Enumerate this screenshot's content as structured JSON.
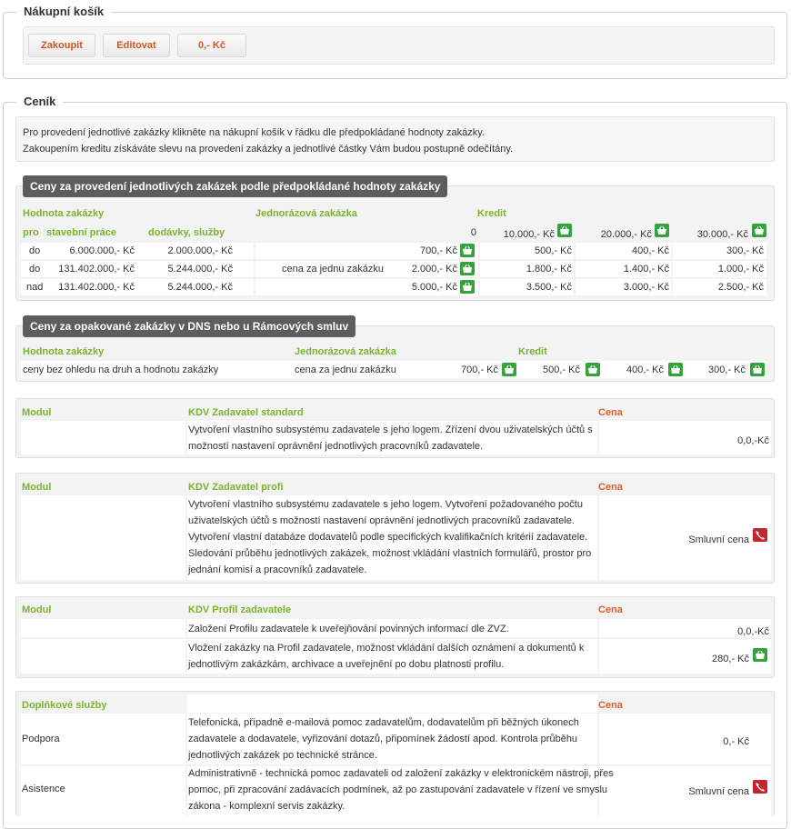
{
  "cart": {
    "title": "Nákupní košík",
    "buttons": {
      "buy": "Zakoupit",
      "edit": "Editovat",
      "total": "0,- Kč"
    }
  },
  "price": {
    "title": "Ceník",
    "info1": "Pro provedení jednotlivé zakázky klikněte na nákupní košík v řádku dle předpokládané hodnoty zakázky.",
    "info2": "Zakoupením kreditu získáváte slevu na provedení zakázky a jednotlivé částky Vám budou postupně odečítány."
  },
  "t1": {
    "title": "Ceny za provedení jednotlivých zakázek podle předpokládané hodnoty zakázky",
    "h_value": "Hodnota zakázky",
    "h_single": "Jednorázová zakázka",
    "h_credit": "Kredit",
    "h_pro": "pro",
    "h_construction": "stavební práce",
    "h_supplies": "dodávky, služby",
    "credit_zero": "0",
    "credits": [
      "10.000,- Kč",
      "20.000,- Kč",
      "30.000,- Kč"
    ],
    "single_note": "cena za jednu zakázku",
    "rows": [
      {
        "pro": "do",
        "construction": "6.000.000,- Kč",
        "supplies": "2.000.000,- Kč",
        "single": "700,- Kč",
        "c1": "500,- Kč",
        "c2": "400,- Kč",
        "c3": "300,- Kč"
      },
      {
        "pro": "do",
        "construction": "131.402.000,- Kč",
        "supplies": "5.244.000,- Kč",
        "single": "2.000,- Kč",
        "c1": "1.800,- Kč",
        "c2": "1.400,- Kč",
        "c3": "1.000,- Kč"
      },
      {
        "pro": "nad",
        "construction": "131.402.000,- Kč",
        "supplies": "5.244.000,- Kč",
        "single": "5.000,- Kč",
        "c1": "3.500,- Kč",
        "c2": "3.000,- Kč",
        "c3": "2.500,- Kč"
      }
    ]
  },
  "t2": {
    "title": "Ceny za opakované zakázky v DNS nebo u Rámcových smluv",
    "h_value": "Hodnota zakázky",
    "h_single": "Jednorázová zakázka",
    "h_credit": "Kredit",
    "row_label": "ceny bez ohledu na druh a hodnotu zakázky",
    "single_note": "cena za jednu zakázku",
    "single": "700,- Kč",
    "c1": "500,- Kč",
    "c2": "400,- Kč",
    "c3": "300,- Kč"
  },
  "m1": {
    "h_module": "Modul",
    "name": "KDV Zadavatel standard",
    "h_price": "Cena",
    "desc1": "Vytvoření vlastního subsystému zadavatele s jeho logem. Zřízení dvou uživatelských účtů s",
    "desc2": "možností nastavení oprávnění jednotlivých pracovníků zadavatele.",
    "price": "0,0,-Kč"
  },
  "m2": {
    "h_module": "Modul",
    "name": "KDV Zadavatel profi",
    "h_price": "Cena",
    "desc": [
      "Vytvoření vlastního subsystému zadavatele s jeho logem. Vytvoření požadovaného počtu",
      "uživatelských účtů s možností nastavení oprávnění jednotlivých pracovníků zadavatele.",
      "Vytvoření vlastní databáze dodavatelů podle specifických kvalifikačních kritérií zadavatele.",
      "Sledování průběhu jednotlivých zakázek, možnost vkládání vlastních formulářů, prostor pro",
      "jednání komisí a pracovníků zadavatele."
    ],
    "price": "Smluvní cena"
  },
  "m3": {
    "h_module": "Modul",
    "name": "KDV Profil zadavatele",
    "h_price": "Cena",
    "r1_desc": "Založení Profilu zadavatele k uveřejňování povinných informací dle ZVZ.",
    "r1_price": "0,0,-Kč",
    "r2_desc1": "Vložení zakázky na Profil zadavatele, možnost vkládání dalších oznámení a dokumentů k",
    "r2_desc2": "jednotlivým zakázkám, archivace a uveřejnění po dobu platnosti profilu.",
    "r2_price": "280,- Kč"
  },
  "m4": {
    "h_title": "Doplňkové služby",
    "h_price": "Cena",
    "r1_label": "Podpora",
    "r1_desc": [
      "Telefonická, případně e-mailová pomoc zadavatelům, dodavatelům při běžných úkonech",
      "zadavatele a dodavatele, vyřizování dotazů, připomínek žádostí apod. Kontrola průběhu",
      "jednotlivých zakázek po technické stránce."
    ],
    "r1_price": "0,- Kč",
    "r2_label": "Asistence",
    "r2_desc": [
      "Administrativně - technická pomoc zadavateli od založení zakázky v elektronickém nástroji, přes",
      "pomoc, při zpracování zadávacích podmínek, až po zastupování zadavatele v řízení ve smyslu",
      "zákona - komplexní servis zakázky."
    ],
    "r2_price": "Smluvní cena"
  },
  "icons": {
    "basket": "basket-icon",
    "phone": "phone-icon"
  },
  "colors": {
    "accent_green": "#7ab32e",
    "accent_orange": "#e85a1e",
    "basket_bg": "#34a33c",
    "phone_bg": "#c2262e"
  }
}
